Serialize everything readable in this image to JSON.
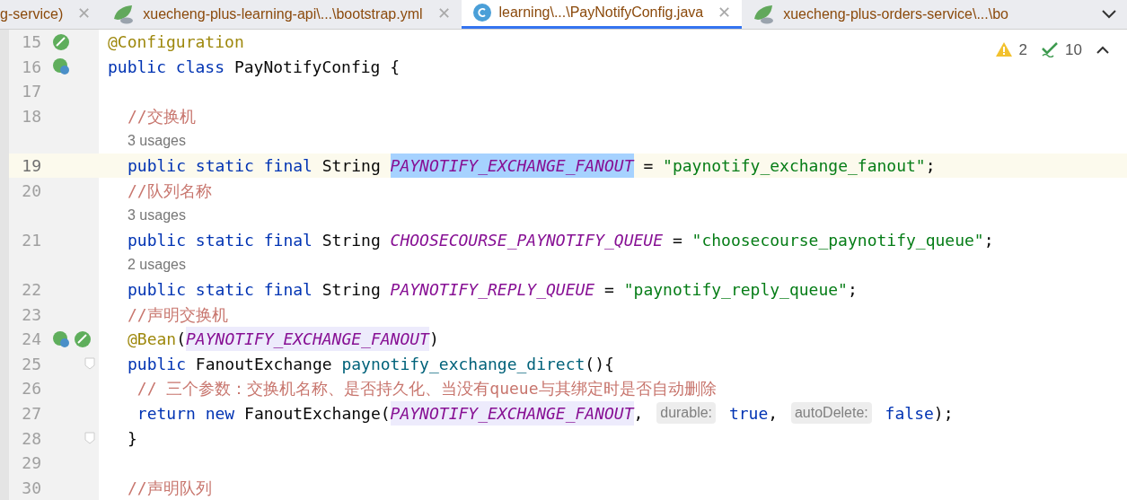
{
  "tabs": [
    {
      "label": "g-service)",
      "kind": "plain",
      "selected": false,
      "close": "✕"
    },
    {
      "label": "xuecheng-plus-learning-api\\...\\bootstrap.yml",
      "kind": "config",
      "selected": false,
      "close": "✕"
    },
    {
      "label": "learning\\...\\PayNotifyConfig.java",
      "kind": "class",
      "selected": true,
      "close": "✕"
    },
    {
      "label": "xuecheng-plus-orders-service\\...\\bo",
      "kind": "config",
      "selected": false
    }
  ],
  "inspections": {
    "warnings": "2",
    "weak_warnings": "10"
  },
  "lines": [
    {
      "kind": "code",
      "number": "15",
      "gutter": [
        {
          "kind": "bean"
        }
      ],
      "tokens": [
        {
          "text": "@Configuration",
          "kind": "annotation"
        }
      ]
    },
    {
      "kind": "code",
      "number": "16",
      "gutter": [
        {
          "kind": "linked"
        }
      ],
      "tokens": [
        {
          "text": "public class ",
          "kind": "keyword"
        },
        {
          "text": "PayNotifyConfig {",
          "kind": "plain"
        }
      ],
      "children": [
        {
          "kind": "code",
          "number": "17"
        },
        {
          "kind": "code",
          "number": "18",
          "tokens": [
            {
              "text": "//交换机",
              "kind": "comment"
            }
          ]
        },
        {
          "kind": "usages",
          "text": "3 usages"
        },
        {
          "kind": "code",
          "number": "19",
          "current": true,
          "tokens": [
            {
              "text": "public static final ",
              "kind": "keyword"
            },
            {
              "text": "String ",
              "kind": "plain"
            },
            {
              "text": "PAYNOTIFY_EXCHANGE_FANOUT",
              "kind": "field",
              "selected": true,
              "highlighted": false
            },
            {
              "text": " = ",
              "kind": "plain"
            },
            {
              "text": "\"paynotify_exchange_fanout\"",
              "kind": "string"
            },
            {
              "text": ";",
              "kind": "plain"
            }
          ]
        },
        {
          "kind": "code",
          "number": "20",
          "current": false,
          "tokens": [
            {
              "text": "//队列名称",
              "kind": "comment"
            }
          ]
        },
        {
          "kind": "usages",
          "text": "3 usages"
        },
        {
          "kind": "code",
          "number": "21",
          "tokens": [
            {
              "text": "public static final ",
              "kind": "keyword"
            },
            {
              "text": "String ",
              "kind": "plain"
            },
            {
              "text": "CHOOSECOURSE_PAYNOTIFY_QUEUE",
              "kind": "field",
              "selected": false,
              "highlighted": false
            },
            {
              "text": " = ",
              "kind": "plain"
            },
            {
              "text": "\"choosecourse_paynotify_queue\"",
              "kind": "string"
            },
            {
              "text": ";",
              "kind": "plain"
            }
          ]
        },
        {
          "kind": "usages",
          "text": "2 usages"
        },
        {
          "kind": "code",
          "number": "22",
          "tokens": [
            {
              "text": "public static final ",
              "kind": "keyword"
            },
            {
              "text": "String ",
              "kind": "plain"
            },
            {
              "text": "PAYNOTIFY_REPLY_QUEUE",
              "kind": "field",
              "selected": false,
              "highlighted": false
            },
            {
              "text": " = ",
              "kind": "plain"
            },
            {
              "text": "\"paynotify_reply_queue\"",
              "kind": "string"
            },
            {
              "text": ";",
              "kind": "plain"
            }
          ]
        },
        {
          "kind": "code",
          "number": "23",
          "tokens": [
            {
              "text": "//声明交换机",
              "kind": "comment"
            }
          ]
        },
        {
          "kind": "code",
          "number": "24",
          "gutter": [
            {
              "kind": "linked"
            },
            {
              "kind": "bean"
            }
          ],
          "tokens": [
            {
              "text": "@Bean",
              "kind": "annotation"
            },
            {
              "text": "(",
              "kind": "plain"
            },
            {
              "text": "PAYNOTIFY_EXCHANGE_FANOUT",
              "kind": "field",
              "selected": false,
              "highlighted": true
            },
            {
              "text": ")",
              "kind": "plain"
            }
          ]
        },
        {
          "kind": "code",
          "number": "25",
          "fold": true,
          "tokens": [
            {
              "text": "public ",
              "kind": "keyword"
            },
            {
              "text": "FanoutExchange ",
              "kind": "plain"
            },
            {
              "text": "paynotify_exchange_direct",
              "kind": "method"
            },
            {
              "text": "(){",
              "kind": "plain"
            }
          ]
        },
        {
          "kind": "code",
          "number": "26",
          "tokens": [
            {
              "text": " // 三个参数：交换机名称、是否持久化、当没有queue与其绑定时是否自动删除",
              "kind": "comment"
            }
          ]
        },
        {
          "kind": "code",
          "number": "27",
          "tokens": [
            {
              "text": " return new ",
              "kind": "keyword"
            },
            {
              "text": "FanoutExchange(",
              "kind": "plain"
            },
            {
              "text": "PAYNOTIFY_EXCHANGE_FANOUT",
              "kind": "field",
              "selected": false,
              "highlighted": true
            },
            {
              "text": ", ",
              "kind": "plain"
            },
            {
              "text": "durable:",
              "kind": "hint"
            },
            {
              "text": " true",
              "kind": "keyword"
            },
            {
              "text": ", ",
              "kind": "plain"
            },
            {
              "text": "autoDelete:",
              "kind": "hint"
            },
            {
              "text": " false",
              "kind": "keyword"
            },
            {
              "text": ");",
              "kind": "plain"
            }
          ]
        },
        {
          "kind": "code",
          "number": "28",
          "fold": true,
          "tokens": [
            {
              "text": "}",
              "kind": "plain"
            }
          ]
        },
        {
          "kind": "code",
          "number": "29"
        },
        {
          "kind": "code",
          "number": "30",
          "tokens": [
            {
              "text": "//声明队列",
              "kind": "comment"
            }
          ]
        }
      ]
    }
  ]
}
